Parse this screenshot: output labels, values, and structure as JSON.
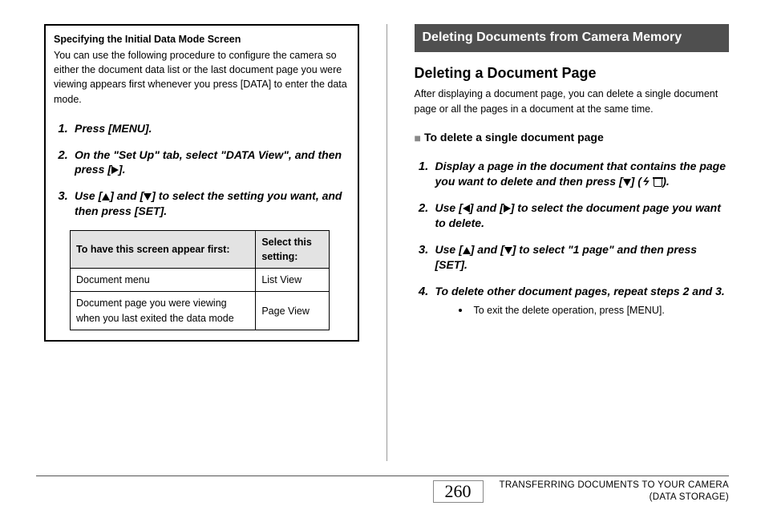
{
  "left": {
    "box_title": "Specifying the Initial Data Mode Screen",
    "box_text": "You can use the following procedure to configure the camera so either the document data list or the last document page you were viewing appears first whenever you press [DATA] to enter the data mode.",
    "steps": {
      "s1": "Press [MENU].",
      "s2a": "On the \"Set Up\" tab, select \"DATA View\", and then press [",
      "s2b": "].",
      "s3a": "Use [",
      "s3b": "] and [",
      "s3c": "] to select the setting you want, and then press [SET]."
    },
    "table": {
      "h1": "To have this screen appear first:",
      "h2": "Select this setting:",
      "r1c1": "Document menu",
      "r1c2": "List View",
      "r2c1": "Document page you were viewing when you last exited the data mode",
      "r2c2": "Page View"
    }
  },
  "right": {
    "bar": "Deleting Documents from Camera Memory",
    "h2": "Deleting a Document Page",
    "para": "After displaying a document page, you can delete a single document page or all the pages in a document at the same time.",
    "sub_h": "To delete a single document page",
    "steps": {
      "s1a": "Display a page in the document that contains the page you want to delete and then press [",
      "s1b": "] (",
      "s1c": ").",
      "s2a": "Use [",
      "s2b": "] and [",
      "s2c": "] to select the document page you want to delete.",
      "s3a": "Use [",
      "s3b": "] and [",
      "s3c": "] to select \"1 page\" and then press [SET].",
      "s4": "To delete other document pages, repeat steps 2 and 3.",
      "s4_bullet": "To exit the delete operation, press [MENU]."
    }
  },
  "footer": {
    "page": "260",
    "line1": "TRANSFERRING DOCUMENTS TO YOUR CAMERA",
    "line2": "(DATA STORAGE)"
  }
}
